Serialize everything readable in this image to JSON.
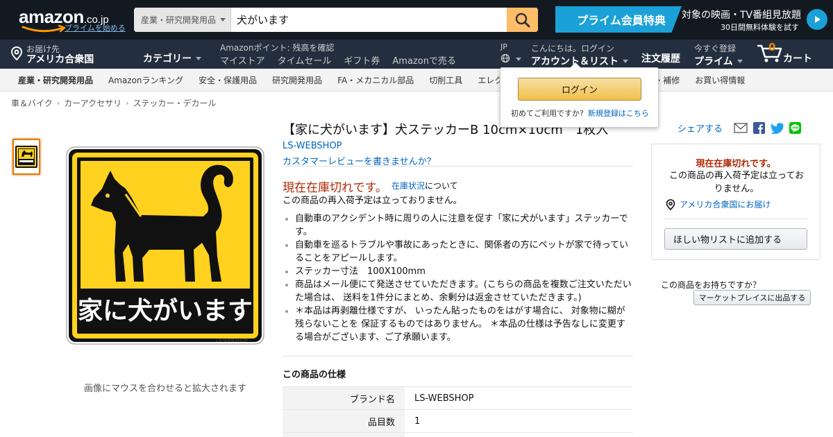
{
  "header": {
    "logo_text": "amazon",
    "logo_tld": ".co.jp",
    "logo_prime_link": "プライムを始める",
    "search_category": "産業・研究開発用品",
    "search_value": "犬がいます",
    "prime_banner": {
      "label": "プライム会員特典",
      "line1": "対象の映画・TV番組見放題",
      "line2": "30日間無料体験を試す"
    },
    "deliver_to_line1": "お届け先",
    "deliver_to_line2": "アメリカ合衆国",
    "categories_label": "カテゴリー",
    "points_text": "Amazonポイント: 残高を確認",
    "subnav": [
      "マイストア",
      "タイムセール",
      "ギフト券",
      "Amazonで売る"
    ],
    "lang": "JP",
    "account_line1": "こんにちは。ログイン",
    "account_line2": "アカウント＆リスト",
    "orders": "注文履歴",
    "prime_line1": "今すぐ登録",
    "prime_line2": "プライム",
    "cart_count": "0",
    "cart_label": "カート"
  },
  "category_bar": [
    "産業・研究開発用品",
    "Amazonランキング",
    "安全・保護用品",
    "研究開発用品",
    "FA・メカニカル部品",
    "切削工具",
    "エレク",
    "着・補修",
    "お買い得情報"
  ],
  "breadcrumb": [
    "車＆バイク",
    "カーアクセサリ",
    "ステッカー・デカール"
  ],
  "flyout": {
    "login_button": "ログイン",
    "first_time": "初めてご利用ですか?",
    "signup_link": "新規登録はこちら"
  },
  "product": {
    "image_text": "家に犬がいます",
    "image_watermark": "LS-WEBSHOP",
    "hover_note": "画像にマウスを合わせると拡大されます",
    "title": "【家に犬がいます】犬ステッカーB 10cm×10cm　1枚入",
    "brand": "LS-WEBSHOP",
    "review_link": "カスタマーレビューを書きませんか？",
    "out_of_stock": "現在在庫切れです。",
    "stock_link": "在庫状況",
    "stock_suffix": "について",
    "restock_note": "この商品の再入荷予定は立っておりません。",
    "bullets": [
      "自動車のアクシデント時に周りの人に注意を促す「家に犬がいます」ステッカーです。",
      "自動車を巡るトラブルや事故にあったときに、関係者の方にペットが家で待っていることをアピールします。",
      "ステッカー寸法　100X100mm",
      "商品はメール便にて発送させていただきます。(こちらの商品を複数ご注文いただいた場合は、 送料を1件分にまとめ、余剰分は返金させていただきます。)",
      "＊本品は再剥離仕様ですが、 いったん貼ったものをはがす場合に、 対象物に糊が残らないことを 保証するものではありません。 ＊本品の仕様は予告なしに変更する場合がございます、ご了承願います。"
    ],
    "spec_title": "この商品の仕様",
    "specs": [
      {
        "key": "ブランド名",
        "value": "LS-WEBSHOP"
      },
      {
        "key": "品目数",
        "value": "1"
      }
    ]
  },
  "right_column": {
    "share_label": "シェアする",
    "buybox_oos": "現在在庫切れです。",
    "buybox_msg": "この商品の再入荷予定は立っておりません。",
    "deliver_link": "アメリカ合衆国にお届け",
    "wishlist_button": "ほしい物リストに追加する",
    "own_question": "この商品をお持ちですか？",
    "sell_button": "マーケットプレイスに出品する"
  },
  "colors": {
    "header_dark": "#131921",
    "header_nav": "#232f3e",
    "search_button": "#febd69",
    "prime_blue": "#1ba1d8",
    "price_red": "#b12704",
    "link_blue": "#0066c0",
    "sticker_yellow": "#ffd21f"
  }
}
